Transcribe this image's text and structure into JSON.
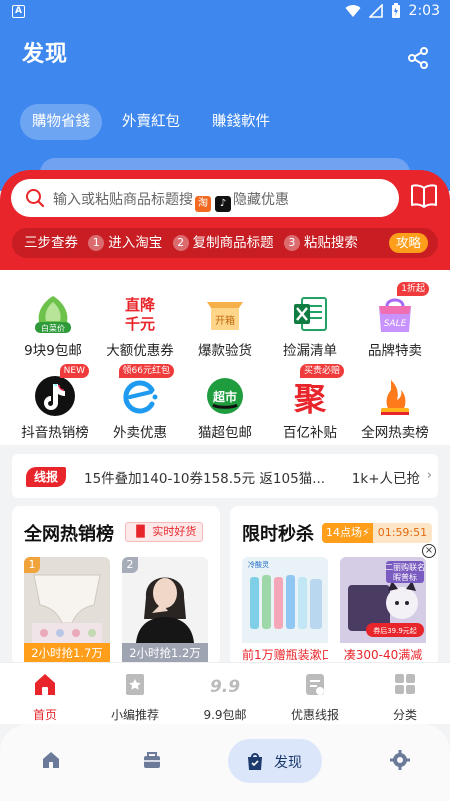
{
  "status_bar": {
    "time": "2:03",
    "left_icon": "A"
  },
  "header": {
    "title": "发现",
    "tabs": [
      {
        "label": "購物省錢"
      },
      {
        "label": "外賣紅包"
      },
      {
        "label": "賺錢軟件"
      }
    ]
  },
  "search": {
    "placeholder_a": "输入或粘贴商品标题搜",
    "taobao_badge": "淘",
    "douyin_badge": "♪",
    "placeholder_b": "隐藏优惠"
  },
  "steps": {
    "lead": "三步查券",
    "items": [
      {
        "num": "1",
        "label": "进入淘宝"
      },
      {
        "num": "2",
        "label": "复制商品标题"
      },
      {
        "num": "3",
        "label": "粘贴搜索"
      }
    ],
    "guide": "攻略"
  },
  "grid": [
    {
      "label": "9块9包邮",
      "icon": "white-price-icon",
      "ico_text": "白菜价"
    },
    {
      "label": "大额优惠券",
      "icon": "big-discount-icon",
      "ico_text1": "直降",
      "ico_text2": "千元"
    },
    {
      "label": "爆款验货",
      "icon": "unboxing-icon",
      "ico_text": "开箱"
    },
    {
      "label": "捡漏清单",
      "icon": "spreadsheet-icon"
    },
    {
      "label": "品牌特卖",
      "icon": "brand-sale-icon",
      "tag": "1折起",
      "ico_text": "SALE"
    },
    {
      "label": "抖音热销榜",
      "icon": "douyin-icon",
      "tag": "NEW"
    },
    {
      "label": "外卖优惠",
      "icon": "eleme-icon",
      "tag": "领66元红包"
    },
    {
      "label": "猫超包邮",
      "icon": "tmall-supermarket-icon",
      "ico_text": "超市"
    },
    {
      "label": "百亿补贴",
      "icon": "juhuasuan-icon",
      "tag": "买贵必赔",
      "ico_text": "聚"
    },
    {
      "label": "全网热卖榜",
      "icon": "hot-sale-icon"
    }
  ],
  "news": {
    "badge": "线报",
    "text": "15件叠加140-10券158.5元 返105猫...",
    "count": "1k+人已抢"
  },
  "hot_card": {
    "title": "全网热销榜",
    "badge": "实时好货",
    "products": [
      {
        "rank": "1",
        "caption": "2小时抢1.7万"
      },
      {
        "rank": "2",
        "caption": "2小时抢1.2万"
      }
    ]
  },
  "flash_card": {
    "title": "限时秒杀",
    "session": "14点场",
    "countdown": "01:59:51",
    "close": "×",
    "products": [
      {
        "caption": "前1万赠瓶装漱口",
        "brand": "冷酸灵"
      },
      {
        "caption": "凑300-40满减",
        "promo_line1": "二丽购联名",
        "promo_line2": "暇普标",
        "promo_tag": "券后39.9元起"
      }
    ]
  },
  "tabbar": [
    {
      "label": "首页",
      "icon": "home-icon"
    },
    {
      "label": "小编推荐",
      "icon": "editor-pick-icon"
    },
    {
      "label": "9.9包邮",
      "icon": "nine-nine-icon",
      "ico_text": "9.9"
    },
    {
      "label": "优惠线报",
      "icon": "deal-report-icon"
    },
    {
      "label": "分类",
      "icon": "category-icon"
    }
  ],
  "bottom_nav": {
    "active_label": "发现"
  },
  "colors": {
    "primary_blue": "#3d87ee",
    "primary_red": "#e8252b",
    "orange": "#ff9e1a"
  }
}
